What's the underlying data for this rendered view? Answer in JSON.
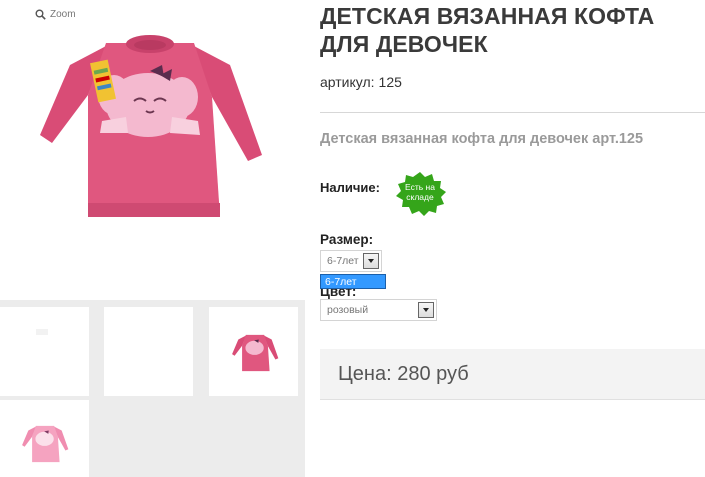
{
  "gallery": {
    "zoom_label": "Zoom"
  },
  "product": {
    "title": "ДЕТСКАЯ ВЯЗАННАЯ КОФТА ДЛЯ ДЕВОЧЕК",
    "sku_label": "артикул:",
    "sku_value": "125",
    "subtitle": "Детская вязанная кофта для девочек арт.125",
    "availability_label": "Наличие:",
    "availability_badge": "Есть на складе",
    "size_label": "Размер:",
    "size_selected": "6-7лет",
    "size_highlighted_option": "6-7лет",
    "color_label": "Цвет:",
    "color_selected": "розовый",
    "price": "Цена: 280 руб"
  },
  "colors": {
    "sweater": "#e0577f",
    "badge": "#35a51a",
    "option_highlight": "#3399ff"
  }
}
